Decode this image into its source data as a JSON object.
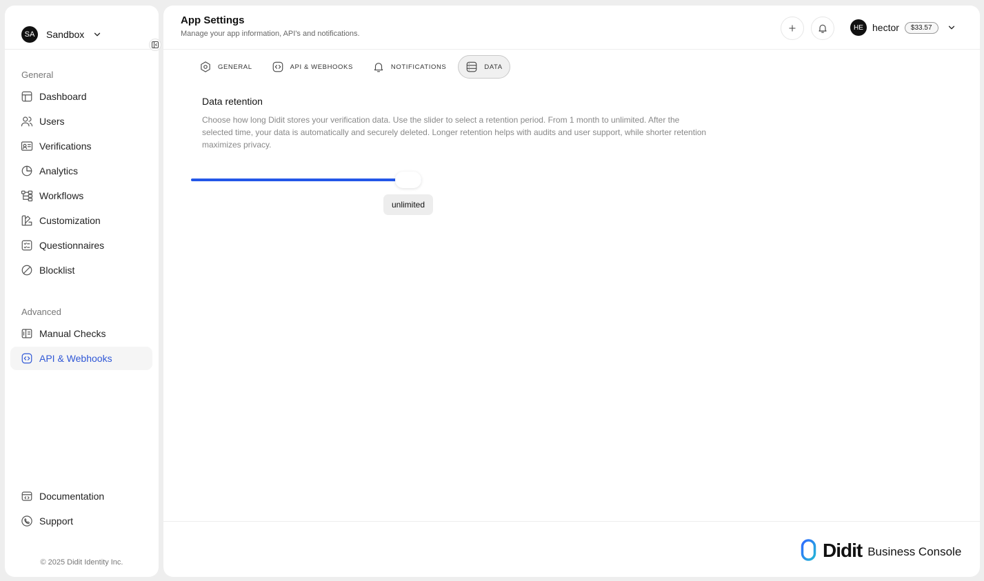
{
  "workspace": {
    "initials": "SA",
    "name": "Sandbox",
    "chevron_icon": "chevron-down-icon"
  },
  "sidebar": {
    "sections": [
      {
        "label": "General",
        "items": [
          {
            "label": "Dashboard",
            "icon": "dashboard-icon"
          },
          {
            "label": "Users",
            "icon": "users-icon"
          },
          {
            "label": "Verifications",
            "icon": "id-card-icon"
          },
          {
            "label": "Analytics",
            "icon": "pie-chart-icon"
          },
          {
            "label": "Workflows",
            "icon": "workflow-icon"
          },
          {
            "label": "Customization",
            "icon": "brush-icon"
          },
          {
            "label": "Questionnaires",
            "icon": "checklist-icon"
          },
          {
            "label": "Blocklist",
            "icon": "block-icon"
          }
        ]
      },
      {
        "label": "Advanced",
        "items": [
          {
            "label": "Manual Checks",
            "icon": "manual-check-icon"
          },
          {
            "label": "API & Webhooks",
            "icon": "code-icon",
            "active": true
          }
        ]
      }
    ],
    "footer_items": [
      {
        "label": "Documentation",
        "icon": "book-icon"
      },
      {
        "label": "Support",
        "icon": "phone-icon"
      }
    ],
    "copyright": "© 2025 Didit Identity Inc."
  },
  "header": {
    "title": "App Settings",
    "subtitle": "Manage your app information, API's and notifications.",
    "user": {
      "initials": "HE",
      "name": "hector",
      "balance": "$33.57"
    }
  },
  "tabs": [
    {
      "label": "GENERAL",
      "icon": "gear-icon"
    },
    {
      "label": "API & WEBHOOKS",
      "icon": "code-icon"
    },
    {
      "label": "NOTIFICATIONS",
      "icon": "bell-icon"
    },
    {
      "label": "DATA",
      "icon": "database-icon",
      "active": true
    }
  ],
  "data_retention": {
    "title": "Data retention",
    "description": "Choose how long Didit stores your verification data. Use the slider to select a retention period. From 1 month to unlimited. After the selected time, your data is automatically and securely deleted. Longer retention helps with audits and user support, while shorter retention maximizes privacy.",
    "slider_value_label": "unlimited",
    "slider_fraction": 1.0
  },
  "brand": {
    "name": "Didit",
    "subtitle": "Business Console"
  },
  "colors": {
    "accent": "#2357e8",
    "active_nav": "#2f57d6"
  }
}
